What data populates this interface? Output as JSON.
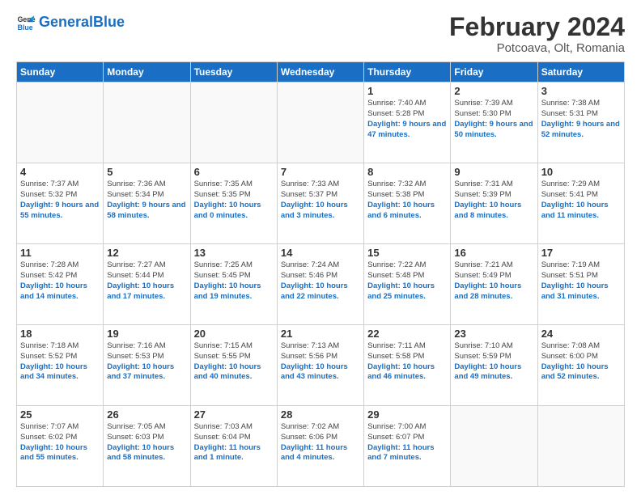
{
  "logo": {
    "text_general": "General",
    "text_blue": "Blue"
  },
  "header": {
    "title": "February 2024",
    "subtitle": "Potcoava, Olt, Romania"
  },
  "weekdays": [
    "Sunday",
    "Monday",
    "Tuesday",
    "Wednesday",
    "Thursday",
    "Friday",
    "Saturday"
  ],
  "weeks": [
    [
      {
        "day": "",
        "empty": true
      },
      {
        "day": "",
        "empty": true
      },
      {
        "day": "",
        "empty": true
      },
      {
        "day": "",
        "empty": true
      },
      {
        "day": "1",
        "sunrise": "7:40 AM",
        "sunset": "5:28 PM",
        "daylight": "9 hours and 47 minutes."
      },
      {
        "day": "2",
        "sunrise": "7:39 AM",
        "sunset": "5:30 PM",
        "daylight": "9 hours and 50 minutes."
      },
      {
        "day": "3",
        "sunrise": "7:38 AM",
        "sunset": "5:31 PM",
        "daylight": "9 hours and 52 minutes."
      }
    ],
    [
      {
        "day": "4",
        "sunrise": "7:37 AM",
        "sunset": "5:32 PM",
        "daylight": "9 hours and 55 minutes."
      },
      {
        "day": "5",
        "sunrise": "7:36 AM",
        "sunset": "5:34 PM",
        "daylight": "9 hours and 58 minutes."
      },
      {
        "day": "6",
        "sunrise": "7:35 AM",
        "sunset": "5:35 PM",
        "daylight": "10 hours and 0 minutes."
      },
      {
        "day": "7",
        "sunrise": "7:33 AM",
        "sunset": "5:37 PM",
        "daylight": "10 hours and 3 minutes."
      },
      {
        "day": "8",
        "sunrise": "7:32 AM",
        "sunset": "5:38 PM",
        "daylight": "10 hours and 6 minutes."
      },
      {
        "day": "9",
        "sunrise": "7:31 AM",
        "sunset": "5:39 PM",
        "daylight": "10 hours and 8 minutes."
      },
      {
        "day": "10",
        "sunrise": "7:29 AM",
        "sunset": "5:41 PM",
        "daylight": "10 hours and 11 minutes."
      }
    ],
    [
      {
        "day": "11",
        "sunrise": "7:28 AM",
        "sunset": "5:42 PM",
        "daylight": "10 hours and 14 minutes."
      },
      {
        "day": "12",
        "sunrise": "7:27 AM",
        "sunset": "5:44 PM",
        "daylight": "10 hours and 17 minutes."
      },
      {
        "day": "13",
        "sunrise": "7:25 AM",
        "sunset": "5:45 PM",
        "daylight": "10 hours and 19 minutes."
      },
      {
        "day": "14",
        "sunrise": "7:24 AM",
        "sunset": "5:46 PM",
        "daylight": "10 hours and 22 minutes."
      },
      {
        "day": "15",
        "sunrise": "7:22 AM",
        "sunset": "5:48 PM",
        "daylight": "10 hours and 25 minutes."
      },
      {
        "day": "16",
        "sunrise": "7:21 AM",
        "sunset": "5:49 PM",
        "daylight": "10 hours and 28 minutes."
      },
      {
        "day": "17",
        "sunrise": "7:19 AM",
        "sunset": "5:51 PM",
        "daylight": "10 hours and 31 minutes."
      }
    ],
    [
      {
        "day": "18",
        "sunrise": "7:18 AM",
        "sunset": "5:52 PM",
        "daylight": "10 hours and 34 minutes."
      },
      {
        "day": "19",
        "sunrise": "7:16 AM",
        "sunset": "5:53 PM",
        "daylight": "10 hours and 37 minutes."
      },
      {
        "day": "20",
        "sunrise": "7:15 AM",
        "sunset": "5:55 PM",
        "daylight": "10 hours and 40 minutes."
      },
      {
        "day": "21",
        "sunrise": "7:13 AM",
        "sunset": "5:56 PM",
        "daylight": "10 hours and 43 minutes."
      },
      {
        "day": "22",
        "sunrise": "7:11 AM",
        "sunset": "5:58 PM",
        "daylight": "10 hours and 46 minutes."
      },
      {
        "day": "23",
        "sunrise": "7:10 AM",
        "sunset": "5:59 PM",
        "daylight": "10 hours and 49 minutes."
      },
      {
        "day": "24",
        "sunrise": "7:08 AM",
        "sunset": "6:00 PM",
        "daylight": "10 hours and 52 minutes."
      }
    ],
    [
      {
        "day": "25",
        "sunrise": "7:07 AM",
        "sunset": "6:02 PM",
        "daylight": "10 hours and 55 minutes."
      },
      {
        "day": "26",
        "sunrise": "7:05 AM",
        "sunset": "6:03 PM",
        "daylight": "10 hours and 58 minutes."
      },
      {
        "day": "27",
        "sunrise": "7:03 AM",
        "sunset": "6:04 PM",
        "daylight": "11 hours and 1 minute."
      },
      {
        "day": "28",
        "sunrise": "7:02 AM",
        "sunset": "6:06 PM",
        "daylight": "11 hours and 4 minutes."
      },
      {
        "day": "29",
        "sunrise": "7:00 AM",
        "sunset": "6:07 PM",
        "daylight": "11 hours and 7 minutes."
      },
      {
        "day": "",
        "empty": true
      },
      {
        "day": "",
        "empty": true
      }
    ]
  ],
  "labels": {
    "sunrise": "Sunrise:",
    "sunset": "Sunset:",
    "daylight": "Daylight:"
  }
}
